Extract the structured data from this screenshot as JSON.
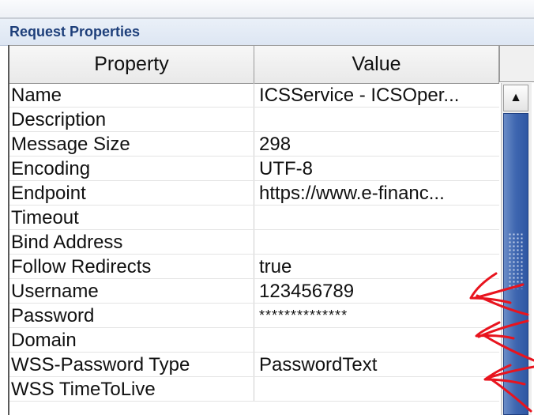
{
  "panel": {
    "title": "Request Properties"
  },
  "table": {
    "headers": {
      "property": "Property",
      "value": "Value"
    },
    "rows": [
      {
        "property": "Name",
        "value": "ICSService - ICSOper..."
      },
      {
        "property": "Description",
        "value": ""
      },
      {
        "property": "Message Size",
        "value": "298"
      },
      {
        "property": "Encoding",
        "value": "UTF-8"
      },
      {
        "property": "Endpoint",
        "value": "https://www.e-financ..."
      },
      {
        "property": "Timeout",
        "value": ""
      },
      {
        "property": "Bind Address",
        "value": ""
      },
      {
        "property": "Follow Redirects",
        "value": "true"
      },
      {
        "property": "Username",
        "value": "123456789"
      },
      {
        "property": "Password",
        "value": "**************"
      },
      {
        "property": "Domain",
        "value": ""
      },
      {
        "property": "WSS-Password Type",
        "value": "PasswordText"
      },
      {
        "property": "WSS TimeToLive",
        "value": ""
      }
    ]
  },
  "scrollbar": {
    "up_arrow": "▲"
  },
  "colors": {
    "annotation": "#e8141e",
    "scroll_thumb": "#3e66b0",
    "title": "#1e3f7a"
  },
  "icons": {
    "scroll_up": "scroll-up-arrow-icon"
  }
}
